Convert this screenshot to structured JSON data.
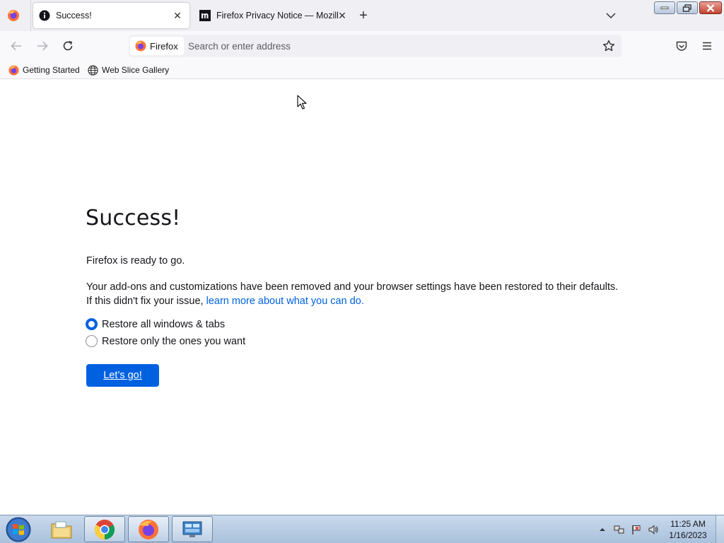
{
  "tabs": [
    {
      "title": "Success!",
      "icon": "info-icon",
      "active": true,
      "close": "✕"
    },
    {
      "title": "Firefox Privacy Notice — Mozilla",
      "icon": "mozilla-m-icon",
      "active": false,
      "close": "✕"
    }
  ],
  "newtab_label": "+",
  "urlbar": {
    "identity_label": "Firefox",
    "placeholder": "Search or enter address"
  },
  "bookmarks": [
    {
      "label": "Getting Started",
      "icon": "firefox-icon"
    },
    {
      "label": "Web Slice Gallery",
      "icon": "globe-icon"
    }
  ],
  "page": {
    "heading": "Success!",
    "ready_text": "Firefox is ready to go.",
    "info_text_1": "Your add-ons and customizations have been removed and your browser settings have been restored to their defaults.",
    "info_text_2": "If this didn't fix your issue,",
    "learn_more_link": "learn more about what you can do.",
    "options": [
      {
        "label": "Restore all windows & tabs",
        "selected": true
      },
      {
        "label": "Restore only the ones you want",
        "selected": false
      }
    ],
    "go_button": "Let’s go!"
  },
  "taskbar": {
    "apps": [
      "windows-explorer",
      "chrome",
      "firefox",
      "control-panel"
    ],
    "clock_time": "11:25 AM",
    "clock_date": "1/16/2023"
  },
  "colors": {
    "accent": "#0061e0",
    "tabstrip": "#f0f0f4",
    "taskbar": "#b9cde4"
  }
}
